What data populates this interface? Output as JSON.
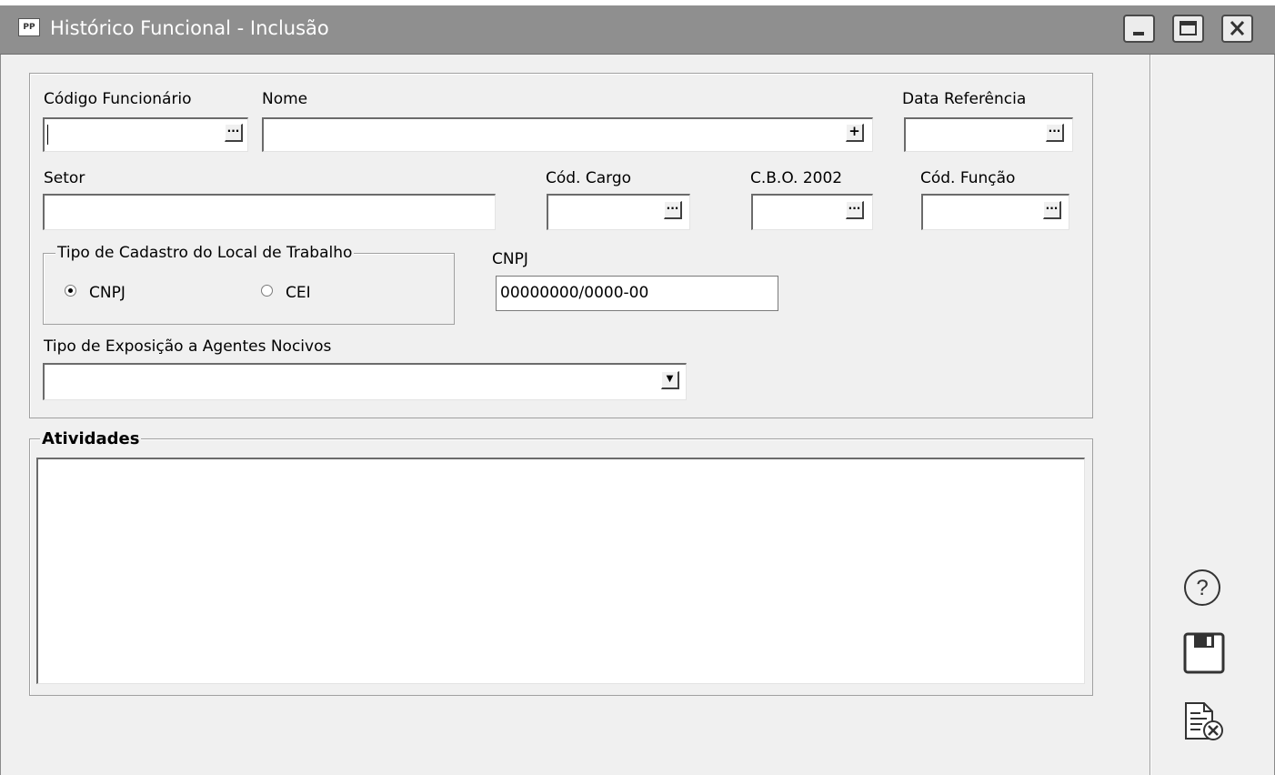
{
  "window": {
    "title": "Histórico Funcional - Inclusão",
    "app_icon": "PP"
  },
  "form": {
    "codigo_funcionario_label": "Código Funcionário",
    "nome_label": "Nome",
    "data_referencia_label": "Data Referência",
    "setor_label": "Setor",
    "cod_cargo_label": "Cód. Cargo",
    "cbo_label": "C.B.O. 2002",
    "cod_funcao_label": "Cód. Função",
    "tipo_cadastro_legend": "Tipo de Cadastro do Local de Trabalho",
    "radio_cnpj_label": "CNPJ",
    "radio_cei_label": "CEI",
    "radio_selected": "CNPJ",
    "cnpj_label": "CNPJ",
    "cnpj_value": "00000000/0000-00",
    "tipo_exposicao_label": "Tipo de Exposição a Agentes Nocivos",
    "ellipsis": "···",
    "plus": "+",
    "dropdown_arrow": "▼"
  },
  "atividades": {
    "legend": "Atividades"
  },
  "icons": [
    "help-icon",
    "save-icon",
    "cancel-document-icon",
    "minimize-icon",
    "maximize-icon",
    "close-icon"
  ]
}
